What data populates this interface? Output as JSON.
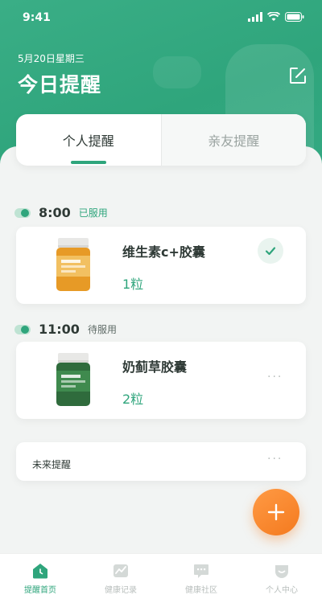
{
  "status_bar": {
    "time": "9:41"
  },
  "header": {
    "date": "5月20日星期三",
    "title": "今日提醒"
  },
  "tabs": [
    {
      "label": "个人提醒",
      "active": true
    },
    {
      "label": "亲友提醒",
      "active": false
    }
  ],
  "reminders": [
    {
      "time": "8:00",
      "status": "已服用",
      "status_color": "#2fa57c",
      "medicine": "维生素c+胶囊",
      "dose": "1粒",
      "action_icon": "check-icon"
    },
    {
      "time": "11:00",
      "status": "待服用",
      "status_color": "#5f6b67",
      "medicine": "奶蓟草胶囊",
      "dose": "2粒",
      "action_icon": "more-icon"
    }
  ],
  "future": {
    "label": "未来提醒",
    "more": "···"
  },
  "more_dots": "···",
  "fab": {
    "icon": "plus-icon"
  },
  "tabbar": [
    {
      "label": "提醒首页",
      "icon": "home-icon",
      "active": true
    },
    {
      "label": "健康记录",
      "icon": "chart-icon",
      "active": false
    },
    {
      "label": "健康社区",
      "icon": "chat-icon",
      "active": false
    },
    {
      "label": "个人中心",
      "icon": "profile-icon",
      "active": false
    }
  ],
  "colors": {
    "primary": "#2fa57c",
    "accent": "#f47a1f",
    "inactive": "#b9bfbd"
  }
}
